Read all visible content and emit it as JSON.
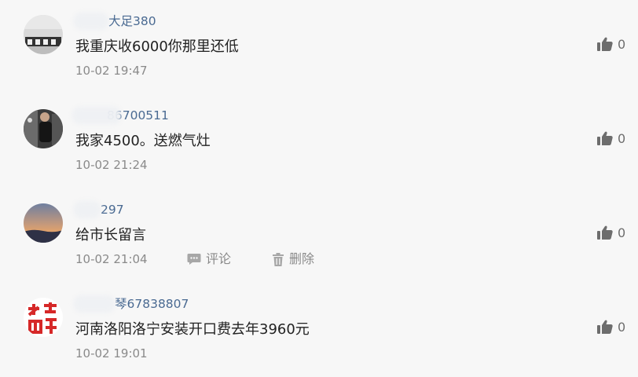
{
  "comments": [
    {
      "username": "大足380",
      "text": "我重庆收6000你那里还低",
      "time": "10-02 19:47",
      "likes": "0"
    },
    {
      "username": "86700511",
      "text": "我家4500。送燃气灶",
      "time": "10-02 21:24",
      "likes": "0"
    },
    {
      "username": "297",
      "text": "给市长留言",
      "time": "10-02 21:04",
      "likes": "0",
      "actions": {
        "comment": "评论",
        "delete": "删除"
      }
    },
    {
      "username": "琴67838807",
      "text": "河南洛阳洛宁安装开口费去年3960元",
      "time": "10-02 19:01",
      "likes": "0"
    }
  ],
  "icons": {
    "like": "thumbs-up-icon",
    "comment": "comment-icon",
    "delete": "trash-icon"
  },
  "colors": {
    "background": "#f7f7f7",
    "username": "#4a6a92",
    "text": "#222222",
    "meta": "#8a8a8a",
    "icon": "#6d6d6d"
  }
}
